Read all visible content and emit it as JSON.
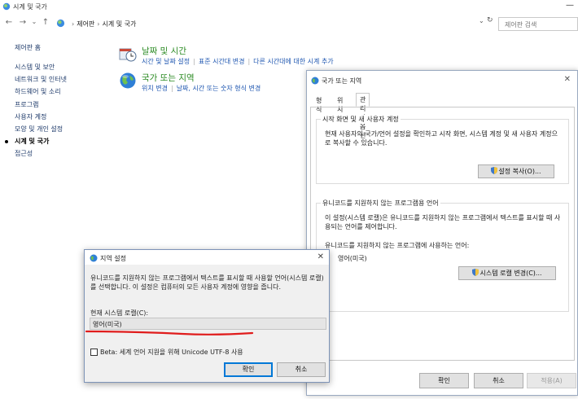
{
  "window": {
    "title": "시계 및 국가",
    "minimize_glyph": "—"
  },
  "address": {
    "back": "←",
    "forward": "→",
    "recent": "⌄",
    "up": "↑",
    "crumbs": [
      "제어판",
      "시계 및 국가"
    ],
    "crumb_sep": "›",
    "dropdown_glyph": "⌄",
    "refresh_glyph": "↻",
    "search_placeholder": "제어판 검색"
  },
  "leftnav": {
    "home": "제어판 홈",
    "items": [
      "시스템 및 보안",
      "네트워크 및 인터넷",
      "하드웨어 및 소리",
      "프로그램",
      "사용자 계정",
      "모양 및 개인 설정",
      "시계 및 국가",
      "접근성"
    ],
    "current_index": 6
  },
  "categories": [
    {
      "title": "날짜 및 시간",
      "links": [
        "시간 및 날짜 설정",
        "표준 시간대 변경",
        "다른 시간대에 대한 시계 추가"
      ]
    },
    {
      "title": "국가 또는 지역",
      "links": [
        "위치 변경",
        "날짜, 시간 또는 숫자 형식 변경"
      ]
    }
  ],
  "region_dialog": {
    "title": "국가 또는 지역",
    "close": "✕",
    "tabs": [
      "형식",
      "위치",
      "관리자 옵션"
    ],
    "active_tab": 2,
    "welcome": {
      "legend": "시작 화면 및 새 사용자 계정",
      "text": "현재 사용자의 국가/언어 설정을 확인하고 시작 화면, 시스템 계정 및 새 사용자 계정으로 복사할 수 있습니다.",
      "button": "설정 복사(O)..."
    },
    "unicode": {
      "legend": "유니코드를 지원하지 않는 프로그램용 언어",
      "text": "이 설정(시스템 로캘)은 유니코드를 지원하지 않는 프로그램에서 텍스트를 표시할 때 사용되는 언어를 제어합니다.",
      "current_label": "유니코드를 지원하지 않는 프로그램에 사용하는 언어:",
      "current_value": "영어(미국)",
      "button": "시스템 로캘 변경(C)..."
    },
    "ok": "확인",
    "cancel": "취소",
    "apply": "적용(A)"
  },
  "locale_dialog": {
    "title": "지역 설정",
    "close": "✕",
    "description": "유니코드를 지원하지 않는 프로그램에서 텍스트를 표시할 때 사용할 언어(시스템 로캘)를 선택합니다. 이 설정은 컴퓨터의 모든 사용자 계정에 영향을 줍니다.",
    "locale_label": "현재 시스템 로캘(C):",
    "locale_value": "영어(미국)",
    "caret": "⌄",
    "beta_label": "Beta: 세계 언어 지원을 위해 Unicode UTF-8 사용",
    "beta_checked": false,
    "ok": "확인",
    "cancel": "취소"
  },
  "colors": {
    "annotation": "#e01c1c",
    "category_title": "#2a8a22",
    "link": "#1e56b0",
    "accent": "#0078d7"
  }
}
